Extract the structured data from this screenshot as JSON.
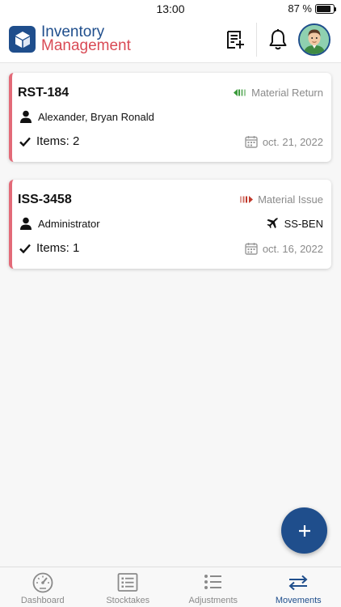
{
  "status_bar": {
    "time": "13:00",
    "battery": "87 %",
    "battery_level": 0.87
  },
  "header": {
    "title_line1": "Inventory",
    "title_line2": "Management",
    "brand_color": "#1f4e8c",
    "accent_color": "#d94a55"
  },
  "movements": [
    {
      "id": "RST-184",
      "type": "Material Return",
      "type_color": "#3a9a3a",
      "user": "Alexander, Bryan Ronald",
      "items": "Items: 2",
      "date": "oct. 21, 2022",
      "destination": ""
    },
    {
      "id": "ISS-3458",
      "type": "Material Issue",
      "type_color": "#c0392b",
      "user": "Administrator",
      "items": "Items: 1",
      "date": "oct. 16, 2022",
      "destination": "SS-BEN"
    }
  ],
  "nav": {
    "items": [
      {
        "label": "Dashboard",
        "icon": "gauge-icon"
      },
      {
        "label": "Stocktakes",
        "icon": "list-box-icon"
      },
      {
        "label": "Adjustments",
        "icon": "bulleted-list-icon"
      },
      {
        "label": "Movements",
        "icon": "arrows-exchange-icon",
        "active": true
      }
    ]
  }
}
